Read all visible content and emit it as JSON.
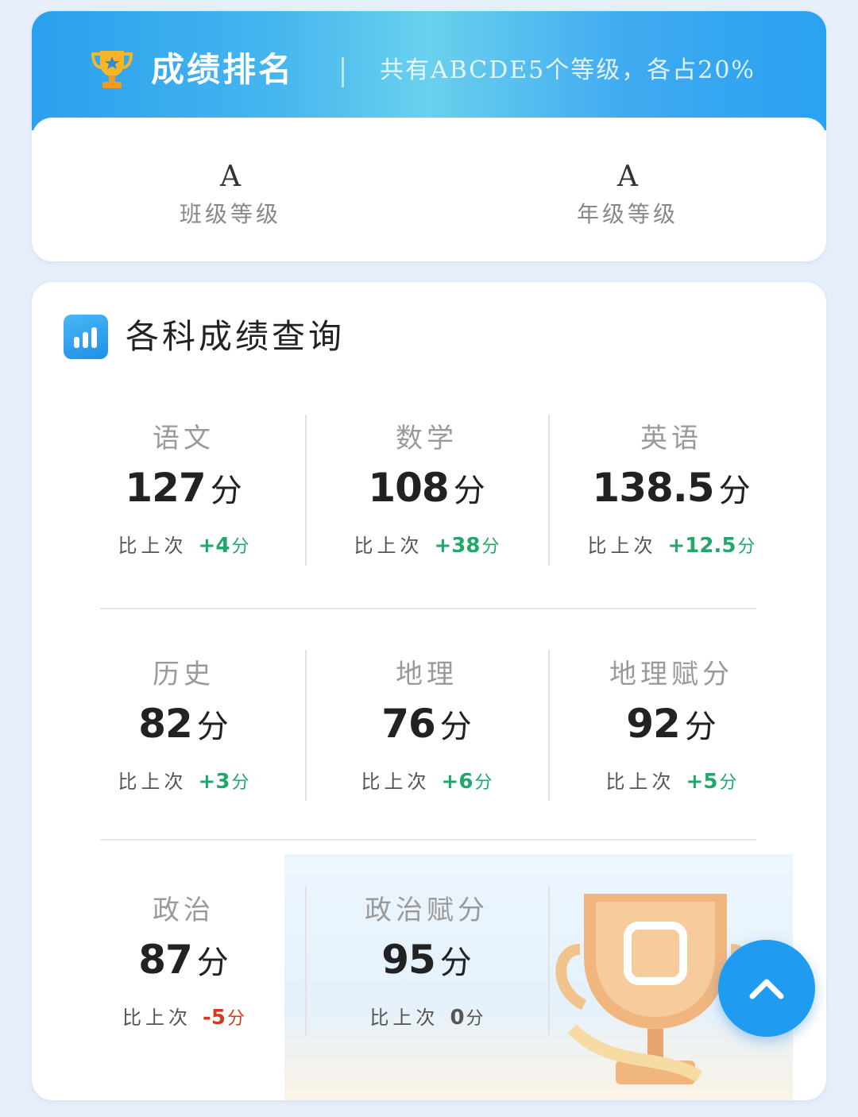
{
  "ranking": {
    "title": "成绩排名",
    "subtitle": "共有ABCDE5个等级，各占20%",
    "class_grade": {
      "value": "A",
      "label": "班级等级"
    },
    "year_grade": {
      "value": "A",
      "label": "年级等级"
    }
  },
  "scores": {
    "title": "各科成绩查询",
    "compare_label": "比上次",
    "unit": "分",
    "subjects": [
      {
        "name": "语文",
        "score": "127",
        "delta": "+4",
        "trend": "up"
      },
      {
        "name": "数学",
        "score": "108",
        "delta": "+38",
        "trend": "up"
      },
      {
        "name": "英语",
        "score": "138.5",
        "delta": "+12.5",
        "trend": "up"
      },
      {
        "name": "历史",
        "score": "82",
        "delta": "+3",
        "trend": "up"
      },
      {
        "name": "地理",
        "score": "76",
        "delta": "+6",
        "trend": "up"
      },
      {
        "name": "地理赋分",
        "score": "92",
        "delta": "+5",
        "trend": "up"
      },
      {
        "name": "政治",
        "score": "87",
        "delta": "-5",
        "trend": "down"
      },
      {
        "name": "政治赋分",
        "score": "95",
        "delta": "0",
        "trend": "flat"
      }
    ]
  },
  "colors": {
    "accent": "#1f9bf0",
    "increase": "#1fa86a",
    "decrease": "#d8391e"
  },
  "icons": [
    "trophy-icon",
    "bar-chart-icon",
    "chevron-up-icon"
  ]
}
